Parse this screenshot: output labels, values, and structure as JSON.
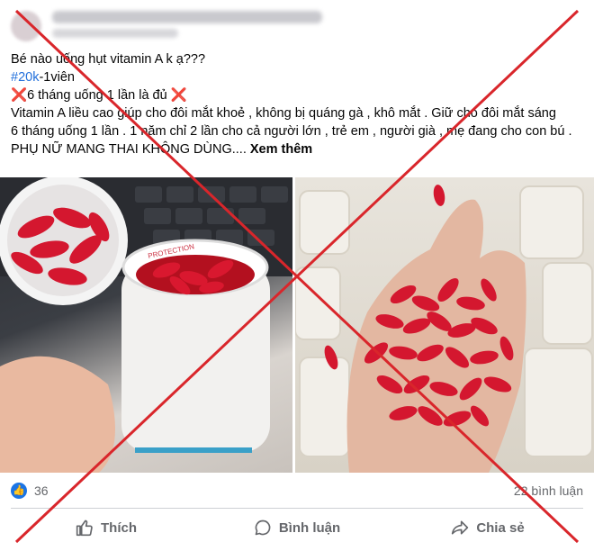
{
  "post": {
    "line1": "Bé nào uống hụt vitamin A k ạ???",
    "hashtag": "#20k",
    "hashtag_suffix": "-1viên",
    "line3_mark": "❌",
    "line3_text": "6 tháng uống 1 lần là đủ ",
    "line3_mark_end": "❌",
    "line4": "Vitamin A liều cao giúp cho đôi mắt khoẻ , không bị quáng gà , khô mắt . Giữ cho đôi mắt sáng",
    "line5": "6 tháng uống 1 lần . 1 năm chỉ 2 lần cho cả người lớn , trẻ em , người già , mẹ đang cho con bú . PHỤ NỮ MANG THAI KHÔNG DÙNG....",
    "see_more": "Xem thêm"
  },
  "photo_left": {
    "bottle_label": "PROTECTION"
  },
  "stats": {
    "likes": "36",
    "comments": "22 bình luận"
  },
  "actions": {
    "like": "Thích",
    "comment": "Bình luận",
    "share": "Chia sẻ"
  },
  "colors": {
    "accent": "#1b74e4",
    "cross": "#d9262b",
    "capsule": "#d4172f"
  }
}
